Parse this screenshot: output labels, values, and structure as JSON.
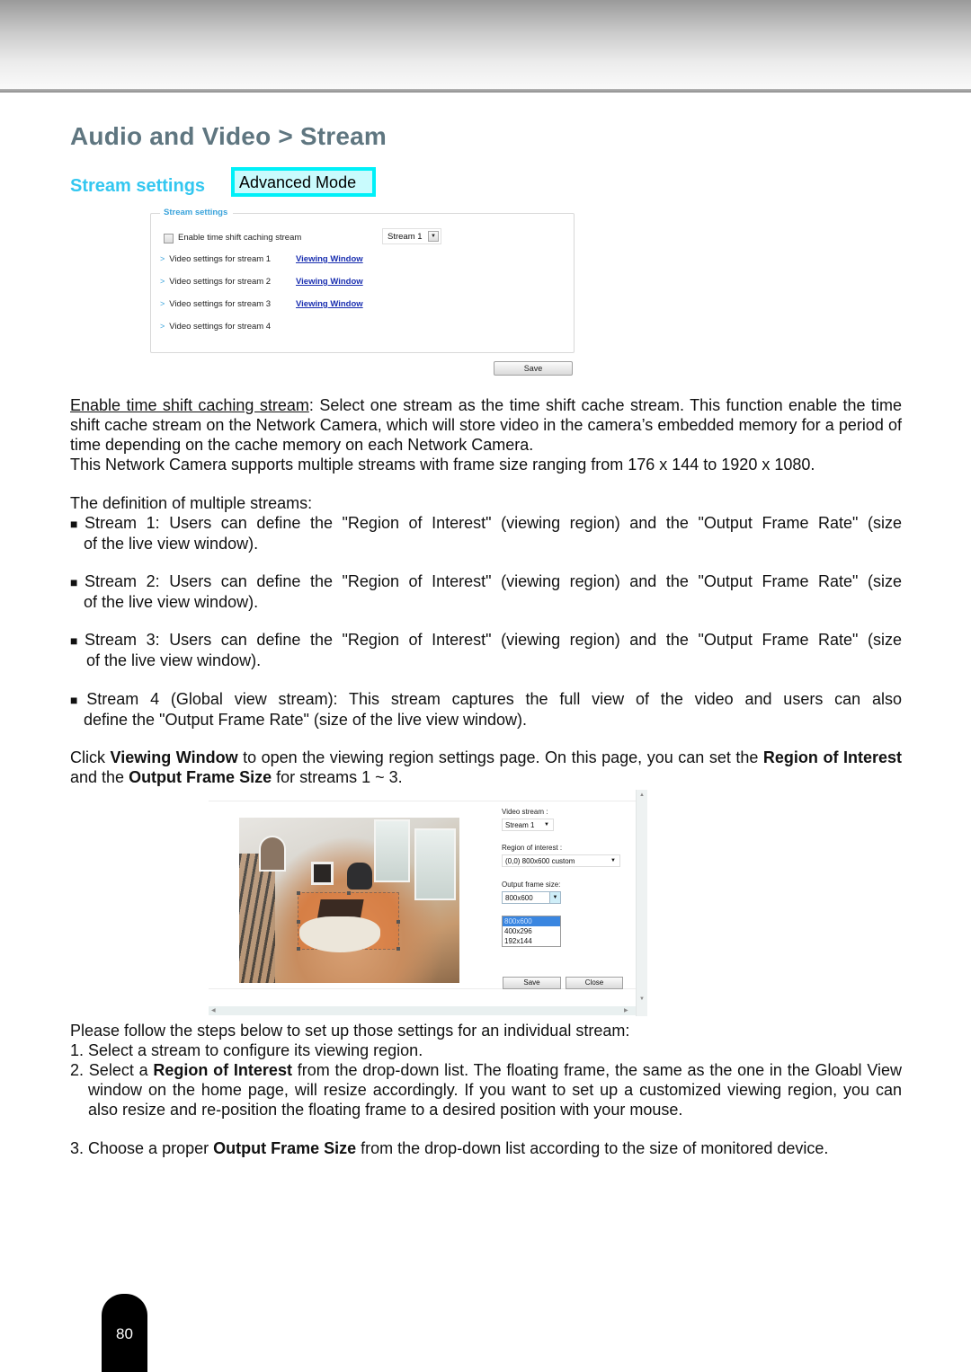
{
  "page": {
    "title": "Audio and Video > Stream",
    "section_heading": "Stream settings",
    "mode_badge": "Advanced Mode",
    "page_number": "80"
  },
  "stream_settings_panel": {
    "legend": "Stream settings",
    "time_shift_checkbox": {
      "label": "Enable time shift caching stream",
      "checked": false
    },
    "time_shift_stream_select": {
      "value": "Stream 1"
    },
    "rows": [
      {
        "label": "Video settings for stream 1",
        "link": "Viewing Window"
      },
      {
        "label": "Video settings for stream 2",
        "link": "Viewing Window"
      },
      {
        "label": "Video settings for stream 3",
        "link": "Viewing Window"
      },
      {
        "label": "Video settings for stream 4",
        "link": null
      }
    ],
    "save_label": "Save"
  },
  "body": {
    "p1_term": "Enable time shift caching stream",
    "p1_rest": ": Select one stream as the time shift cache stream. This function enable the time shift cache stream on the Network Camera, which will store video in the camera’s embedded memory for a period of time depending on the cache memory on each Network Camera.",
    "p2": "This Network Camera supports multiple streams with frame size ranging from 176 x 144 to 1920 x 1080.",
    "p3": "The definition of multiple streams:",
    "bullets": [
      {
        "l1": "Stream 1: Users can define the \"Region of Interest\" (viewing region) and the \"Output Frame Rate\" (size",
        "l2": "of the live view window)."
      },
      {
        "l1": "Stream 2: Users can define the \"Region of Interest\" (viewing region) and the \"Output Frame Rate\" (size",
        "l2": "of the live view window)."
      },
      {
        "l1": "Stream 3: Users can define the \"Region of Interest\" (viewing region) and the \"Output Frame Rate\" (size",
        "l2": " of the live view window)."
      },
      {
        "l1": "Stream 4 (Global view stream): This stream captures the full view of the video and users can also",
        "l2": "define the \"Output Frame Rate\" (size of the live view window)."
      }
    ],
    "p4": {
      "t1": "Click ",
      "b1": "Viewing Window",
      "t2": " to open the viewing region settings page. On this page, you can set the ",
      "b2": "Region of Interest",
      "t3": " and the ",
      "b3": "Output Frame Size",
      "t4": " for streams 1 ~ 3."
    },
    "p5": "Please follow the steps below to set up those settings for an individual stream:",
    "steps": [
      {
        "num": "1.",
        "parts": [
          {
            "t": "Select a stream to configure its viewing region."
          }
        ]
      },
      {
        "num": "2.",
        "parts": [
          {
            "t": "Select a "
          },
          {
            "b": "Region of Interest"
          },
          {
            "t": " from the drop-down list. The floating frame, the same as the one in the Gloabl View window on the home page, will resize accordingly. If you want to set up a customized viewing region, you can also resize and re-position the floating frame to a desired position with your mouse."
          }
        ]
      },
      {
        "num": "3.",
        "parts": [
          {
            "t": "Choose a proper "
          },
          {
            "b": "Output Frame Size"
          },
          {
            "t": " from the drop-down list according to the size of monitored device."
          }
        ]
      }
    ]
  },
  "viewing_window": {
    "video_stream_label": "Video stream :",
    "video_stream_value": "Stream 1",
    "roi_label": "Region of interest :",
    "roi_value": "(0,0) 800x600 custom",
    "output_size_label": "Output frame size:",
    "output_size_value": "800x600",
    "output_size_options": [
      "800x600",
      "400x296",
      "192x144"
    ],
    "output_size_highlighted": "800x600",
    "save_label": "Save",
    "close_label": "Close"
  }
}
